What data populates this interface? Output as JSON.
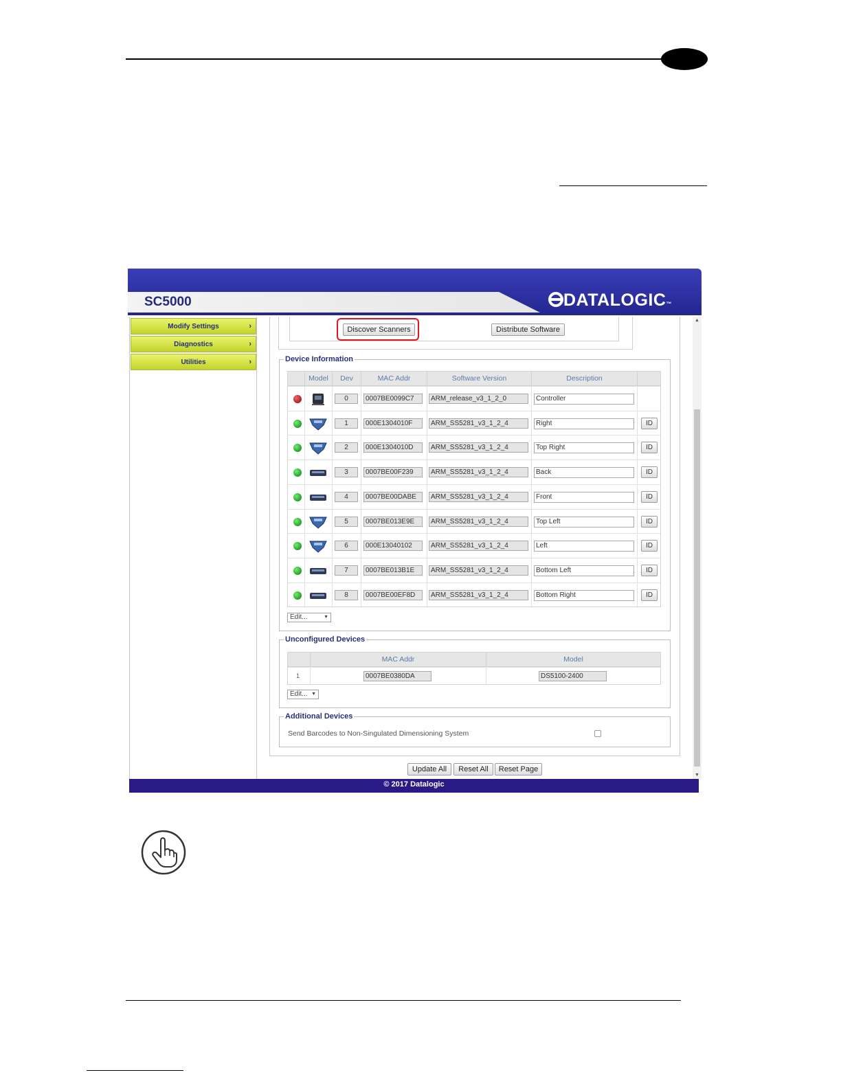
{
  "app": {
    "title": "SC5000",
    "logo_text": "DATALOGIC",
    "logo_tm": "™",
    "footer": "© 2017 Datalogic"
  },
  "sidebar": {
    "items": [
      {
        "label": "Modify Settings"
      },
      {
        "label": "Diagnostics"
      },
      {
        "label": "Utilities"
      }
    ]
  },
  "actions": {
    "discover": "Discover Scanners",
    "distribute": "Distribute Software"
  },
  "device_info": {
    "legend": "Device Information",
    "headers": [
      "Model",
      "Dev",
      "MAC Addr",
      "Software Version",
      "Description"
    ],
    "id_label": "ID",
    "edit_label": "Edit...",
    "rows": [
      {
        "status": "red",
        "model": "controller",
        "dev": "0",
        "mac": "0007BE0099C7",
        "sw": "ARM_release_v3_1_2_0",
        "desc": "Controller",
        "has_id": false
      },
      {
        "status": "green",
        "model": "scanner",
        "dev": "1",
        "mac": "000E1304010F",
        "sw": "ARM_SS5281_v3_1_2_4",
        "desc": "Right",
        "has_id": true
      },
      {
        "status": "green",
        "model": "scanner",
        "dev": "2",
        "mac": "000E1304010D",
        "sw": "ARM_SS5281_v3_1_2_4",
        "desc": "Top Right",
        "has_id": true
      },
      {
        "status": "green",
        "model": "reader",
        "dev": "3",
        "mac": "0007BE00F239",
        "sw": "ARM_SS5281_v3_1_2_4",
        "desc": "Back",
        "has_id": true
      },
      {
        "status": "green",
        "model": "reader",
        "dev": "4",
        "mac": "0007BE00DABE",
        "sw": "ARM_SS5281_v3_1_2_4",
        "desc": "Front",
        "has_id": true
      },
      {
        "status": "green",
        "model": "scanner",
        "dev": "5",
        "mac": "0007BE013E9E",
        "sw": "ARM_SS5281_v3_1_2_4",
        "desc": "Top Left",
        "has_id": true
      },
      {
        "status": "green",
        "model": "scanner",
        "dev": "6",
        "mac": "000E13040102",
        "sw": "ARM_SS5281_v3_1_2_4",
        "desc": "Left",
        "has_id": true
      },
      {
        "status": "green",
        "model": "reader",
        "dev": "7",
        "mac": "0007BE013B1E",
        "sw": "ARM_SS5281_v3_1_2_4",
        "desc": "Bottom Left",
        "has_id": true
      },
      {
        "status": "green",
        "model": "reader",
        "dev": "8",
        "mac": "0007BE00EF8D",
        "sw": "ARM_SS5281_v3_1_2_4",
        "desc": "Bottom Right",
        "has_id": true
      }
    ]
  },
  "unconfigured": {
    "legend": "Unconfigured Devices",
    "headers": [
      "MAC Addr",
      "Model"
    ],
    "edit_label": "Edit...",
    "rows": [
      {
        "index": "1",
        "mac": "0007BE0380DA",
        "model": "DS5100-2400"
      }
    ]
  },
  "additional": {
    "legend": "Additional Devices",
    "option": "Send Barcodes to Non-Singulated Dimensioning System",
    "checked": false
  },
  "bottom_buttons": {
    "update_all": "Update All",
    "reset_all": "Reset All",
    "reset_page": "Reset Page"
  },
  "colors": {
    "accent": "#26307a",
    "nav": "#d6e34a",
    "highlight": "#e0141e",
    "footer": "#2a1a86"
  }
}
